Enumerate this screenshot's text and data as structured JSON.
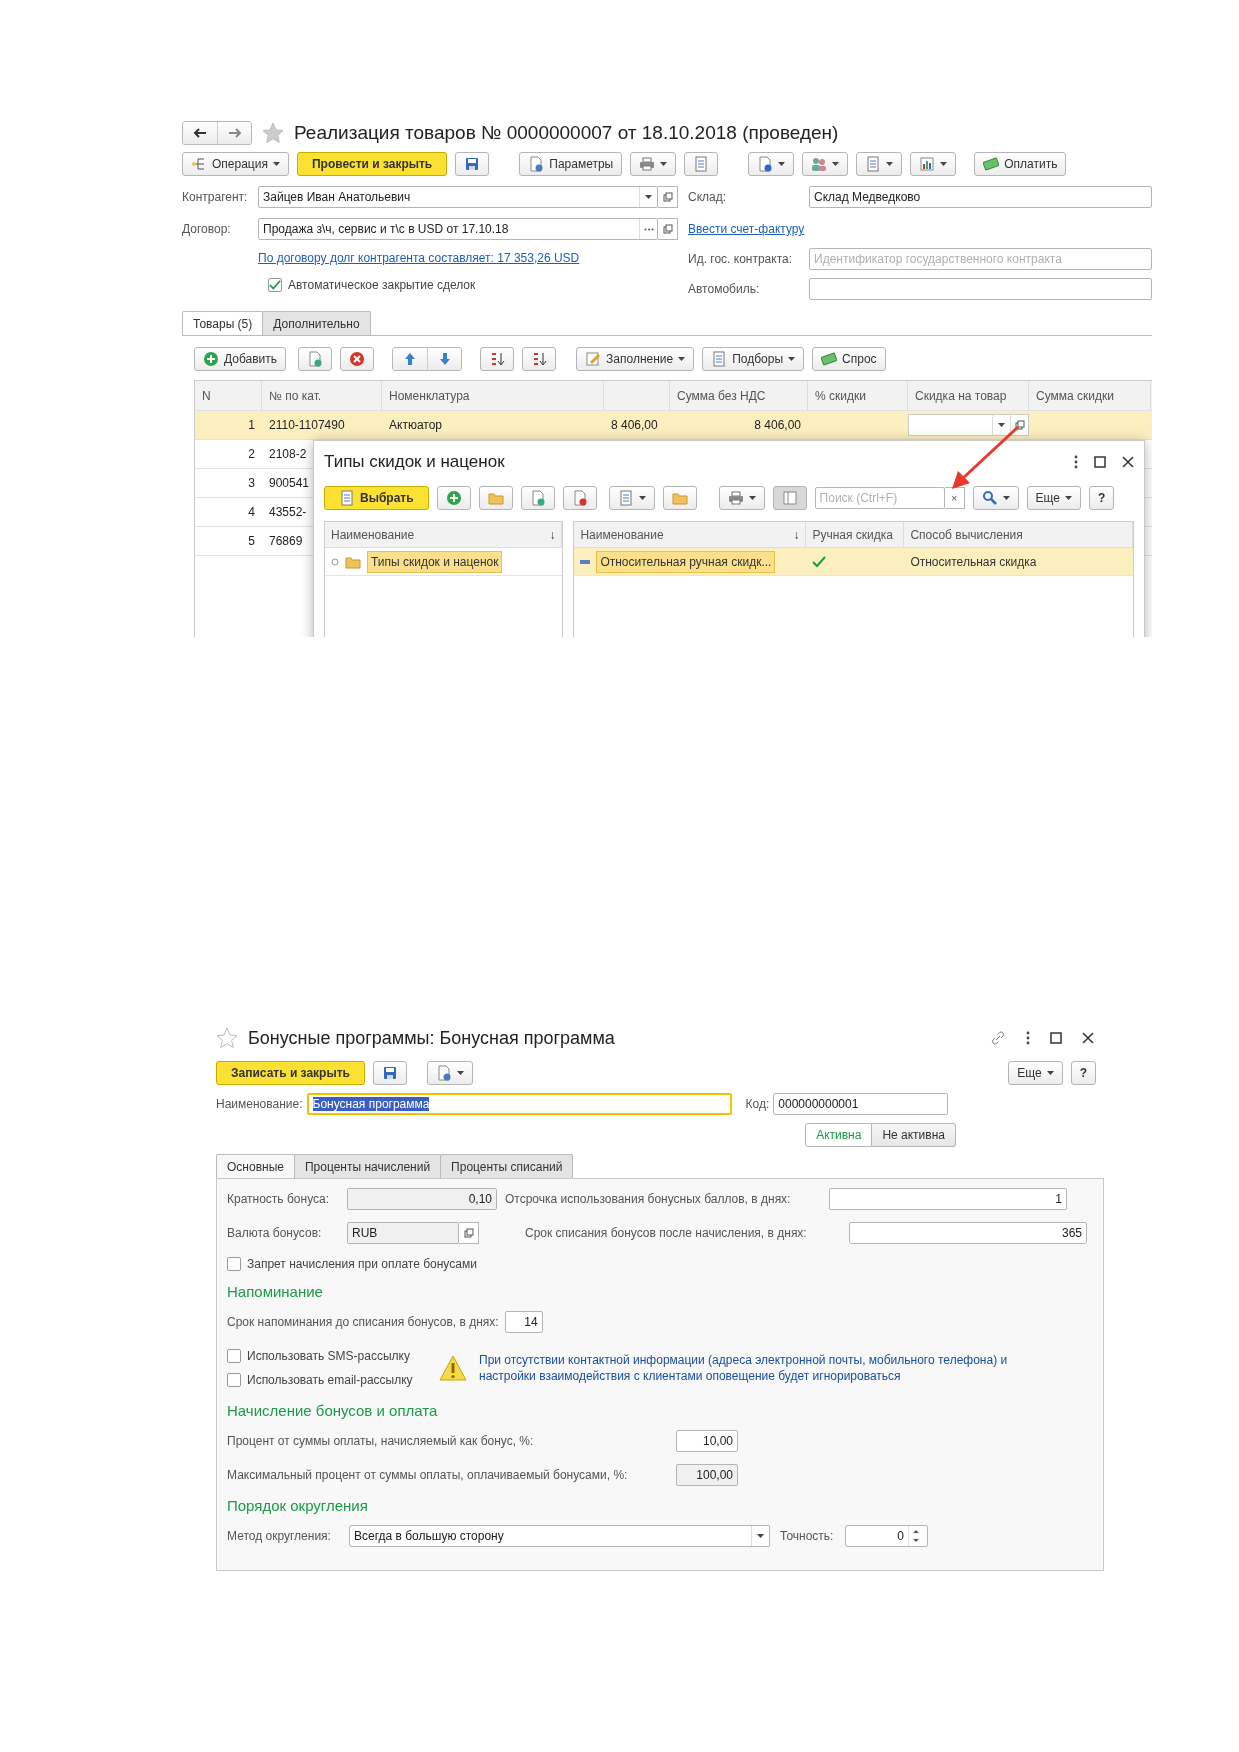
{
  "document": {
    "title": "Реализация товаров № 0000000007  от 18.10.2018 (проведен)",
    "toolbar": {
      "operation": "Операция",
      "post_and_close": "Провести и закрыть",
      "parameters": "Параметры",
      "pay": "Оплатить"
    },
    "fields": {
      "counterparty_label": "Контрагент:",
      "counterparty": "Зайцев Иван Анатольевич",
      "contract_label": "Договор:",
      "contract": "Продажа з\\ч, сервис и т\\с в USD от 17.10.18",
      "debt_link": "По договору долг контрагента составляет: 17 353,26 USD",
      "auto_close": {
        "label": "Автоматическое закрытие сделок",
        "checked": true
      },
      "warehouse_label": "Склад:",
      "warehouse": "Склад Медведково",
      "invoice_link": "Ввести счет-фактуру",
      "gov_contract_label": "Ид. гос. контракта:",
      "gov_contract_placeholder": "Идентификатор государственного контракта",
      "car_label": "Автомобиль:"
    },
    "tabs": [
      {
        "label": "Товары (5)",
        "selected": true
      },
      {
        "label": "Дополнительно",
        "selected": false
      }
    ],
    "table_toolbar": {
      "add": "Добавить",
      "fill": "Заполнение",
      "selections": "Подборы",
      "demand": "Спрос"
    },
    "table": {
      "columns": [
        {
          "label": "N"
        },
        {
          "label": "№ по кат."
        },
        {
          "label": "Номенклатура"
        },
        {},
        {
          "label": "Сумма без НДС"
        },
        {
          "label": "% скидки"
        },
        {
          "label": "Скидка на товар"
        },
        {
          "label": "Сумма скидки"
        }
      ],
      "rows": [
        {
          "n": "1",
          "catalog_no": "2110-1107490",
          "item": "Актюатор",
          "column_4": "8 406,00",
          "sum_without_vat": "8 406,00",
          "selected": true
        },
        {
          "n": "2",
          "catalog_no": "2108-2",
          "selected": false
        },
        {
          "n": "3",
          "catalog_no": "900541",
          "selected": false
        },
        {
          "n": "4",
          "catalog_no": "43552-",
          "selected": false
        },
        {
          "n": "5",
          "catalog_no": "76869",
          "selected": false
        }
      ]
    },
    "dialog": {
      "title": "Типы скидок и наценок",
      "choose": "Выбрать",
      "search_placeholder": "Поиск (Ctrl+F)",
      "clear": "×",
      "more": "Еще",
      "help": "?",
      "tree": {
        "header": "Наименование",
        "sort": "↓",
        "items": [
          {
            "label": "Типы скидок и наценок",
            "selected": true
          }
        ]
      },
      "list": {
        "columns": [
          "Наименование",
          "Ручная скидка",
          "Способ вычисления"
        ],
        "sort": "↓",
        "rows": [
          {
            "name": "Относительная ручная скидк...",
            "manual": true,
            "method": "Относительная скидка",
            "selected": true
          }
        ]
      }
    }
  },
  "bonus": {
    "title": "Бонусные программы: Бонусная программа",
    "save_and_close": "Записать и закрыть",
    "more": "Еще",
    "help": "?",
    "name_label": "Наименование:",
    "name": "Бонусная программа",
    "name_focused": true,
    "code_label": "Код:",
    "code": "000000000001",
    "status": [
      {
        "label": "Активна",
        "selected": true
      },
      {
        "label": "Не активна",
        "selected": false
      }
    ],
    "tabs": [
      {
        "label": "Основные",
        "selected": true
      },
      {
        "label": "Проценты начислений",
        "selected": false
      },
      {
        "label": "Проценты списаний",
        "selected": false
      }
    ],
    "multiplicity": {
      "label": "Кратность бонуса:",
      "value": "0,10",
      "disabled": true
    },
    "delay": {
      "label": "Отсрочка использования бонусных баллов, в днях:",
      "value": "1",
      "disabled": false
    },
    "currency": {
      "label": "Валюта бонусов:",
      "value": "RUB",
      "disabled": true
    },
    "expiry": {
      "label": "Срок списания бонусов после начисления, в днях:",
      "value": "365",
      "disabled": false
    },
    "forbid": {
      "label": "Запрет начисления при оплате бонусами",
      "checked": false
    },
    "reminder_heading": "Напоминание",
    "reminder": {
      "label": "Срок напоминания до списания бонусов, в днях:",
      "value": "14",
      "disabled": false
    },
    "sms": {
      "label": "Использовать SMS-рассылку",
      "checked": false
    },
    "email": {
      "label": "Использовать email-рассылку",
      "checked": false
    },
    "warning": "При отсутствии контактной информации (адреса электронной почты, мобильного телефона) и настройки взаимодействия с клиентами оповещение будет игнорироваться",
    "accrual_heading": "Начисление бонусов и оплата",
    "accrual_percent": {
      "label": "Процент от суммы оплаты, начисляемый как бонус, %:",
      "value": "10,00",
      "disabled": false
    },
    "max_percent": {
      "label": "Максимальный процент от суммы оплаты, оплачиваемый бонусами, %:",
      "value": "100,00",
      "disabled": true
    },
    "rounding_heading": "Порядок округления",
    "rounding_method": {
      "label": "Метод округления:",
      "value": "Всегда в большую сторону"
    },
    "precision": {
      "label": "Точность:",
      "value": "0"
    }
  }
}
